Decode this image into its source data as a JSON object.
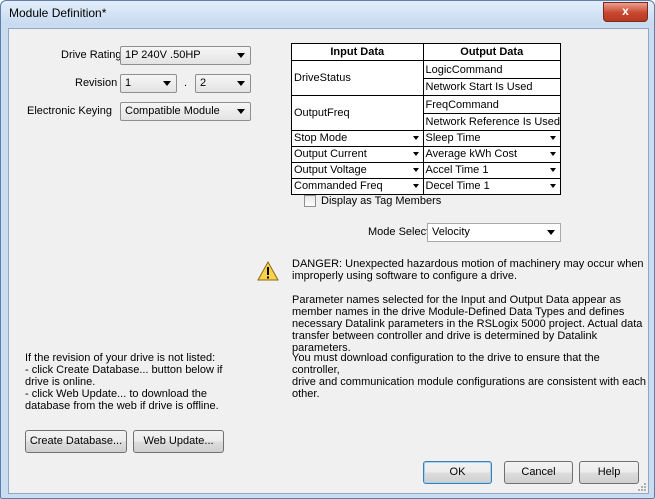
{
  "window": {
    "title": "Module Definition*",
    "close_glyph": "x"
  },
  "left": {
    "drive_rating_label": "Drive Rating",
    "drive_rating_value": "1P 240V  .50HP",
    "revision_label": "Revision",
    "revision_major": "1",
    "revision_separator": ".",
    "revision_minor": "2",
    "keying_label": "Electronic Keying",
    "keying_value": "Compatible Module",
    "revision_help_lines": [
      "If the revision of your drive is not listed:",
      "- click Create Database... button below if",
      "drive is online.",
      "- click Web Update... to download the",
      "database from the web if drive is offline."
    ],
    "create_database_label": "Create Database...",
    "web_update_label": "Web Update..."
  },
  "table": {
    "input_header": "Input Data",
    "output_header": "Output Data",
    "fixed_rows": [
      {
        "input": "DriveStatus",
        "output": [
          "LogicCommand",
          "Network Start Is Used"
        ]
      },
      {
        "input": "OutputFreq",
        "output": [
          "FreqCommand",
          "Network Reference Is Used"
        ]
      }
    ],
    "select_rows": [
      {
        "input": "Stop Mode",
        "output": "Sleep Time"
      },
      {
        "input": "Output Current",
        "output": "Average kWh Cost"
      },
      {
        "input": "Output Voltage",
        "output": "Accel Time 1"
      },
      {
        "input": "Commanded Freq",
        "output": "Decel Time 1"
      }
    ]
  },
  "tag_members_label": "Display as Tag Members",
  "mode_select_label": "Mode Select",
  "mode_select_value": "Velocity",
  "warning": {
    "icon": "warning-triangle-icon",
    "paragraphs": [
      [
        "DANGER: Unexpected hazardous motion of machinery may occur when",
        "improperly using software to configure a drive."
      ],
      [
        "Parameter names selected for the Input and Output Data appear as",
        "member names in the drive Module-Defined Data Types and defines",
        "necessary Datalink parameters in the RSLogix 5000 project.  Actual data",
        "transfer between controller and drive is determined by Datalink parameters."
      ],
      [
        "You must download configuration to the drive to ensure that the controller,",
        "drive and communication module configurations are consistent with each",
        "other."
      ]
    ]
  },
  "buttons": {
    "ok": "OK",
    "cancel": "Cancel",
    "help": "Help"
  }
}
